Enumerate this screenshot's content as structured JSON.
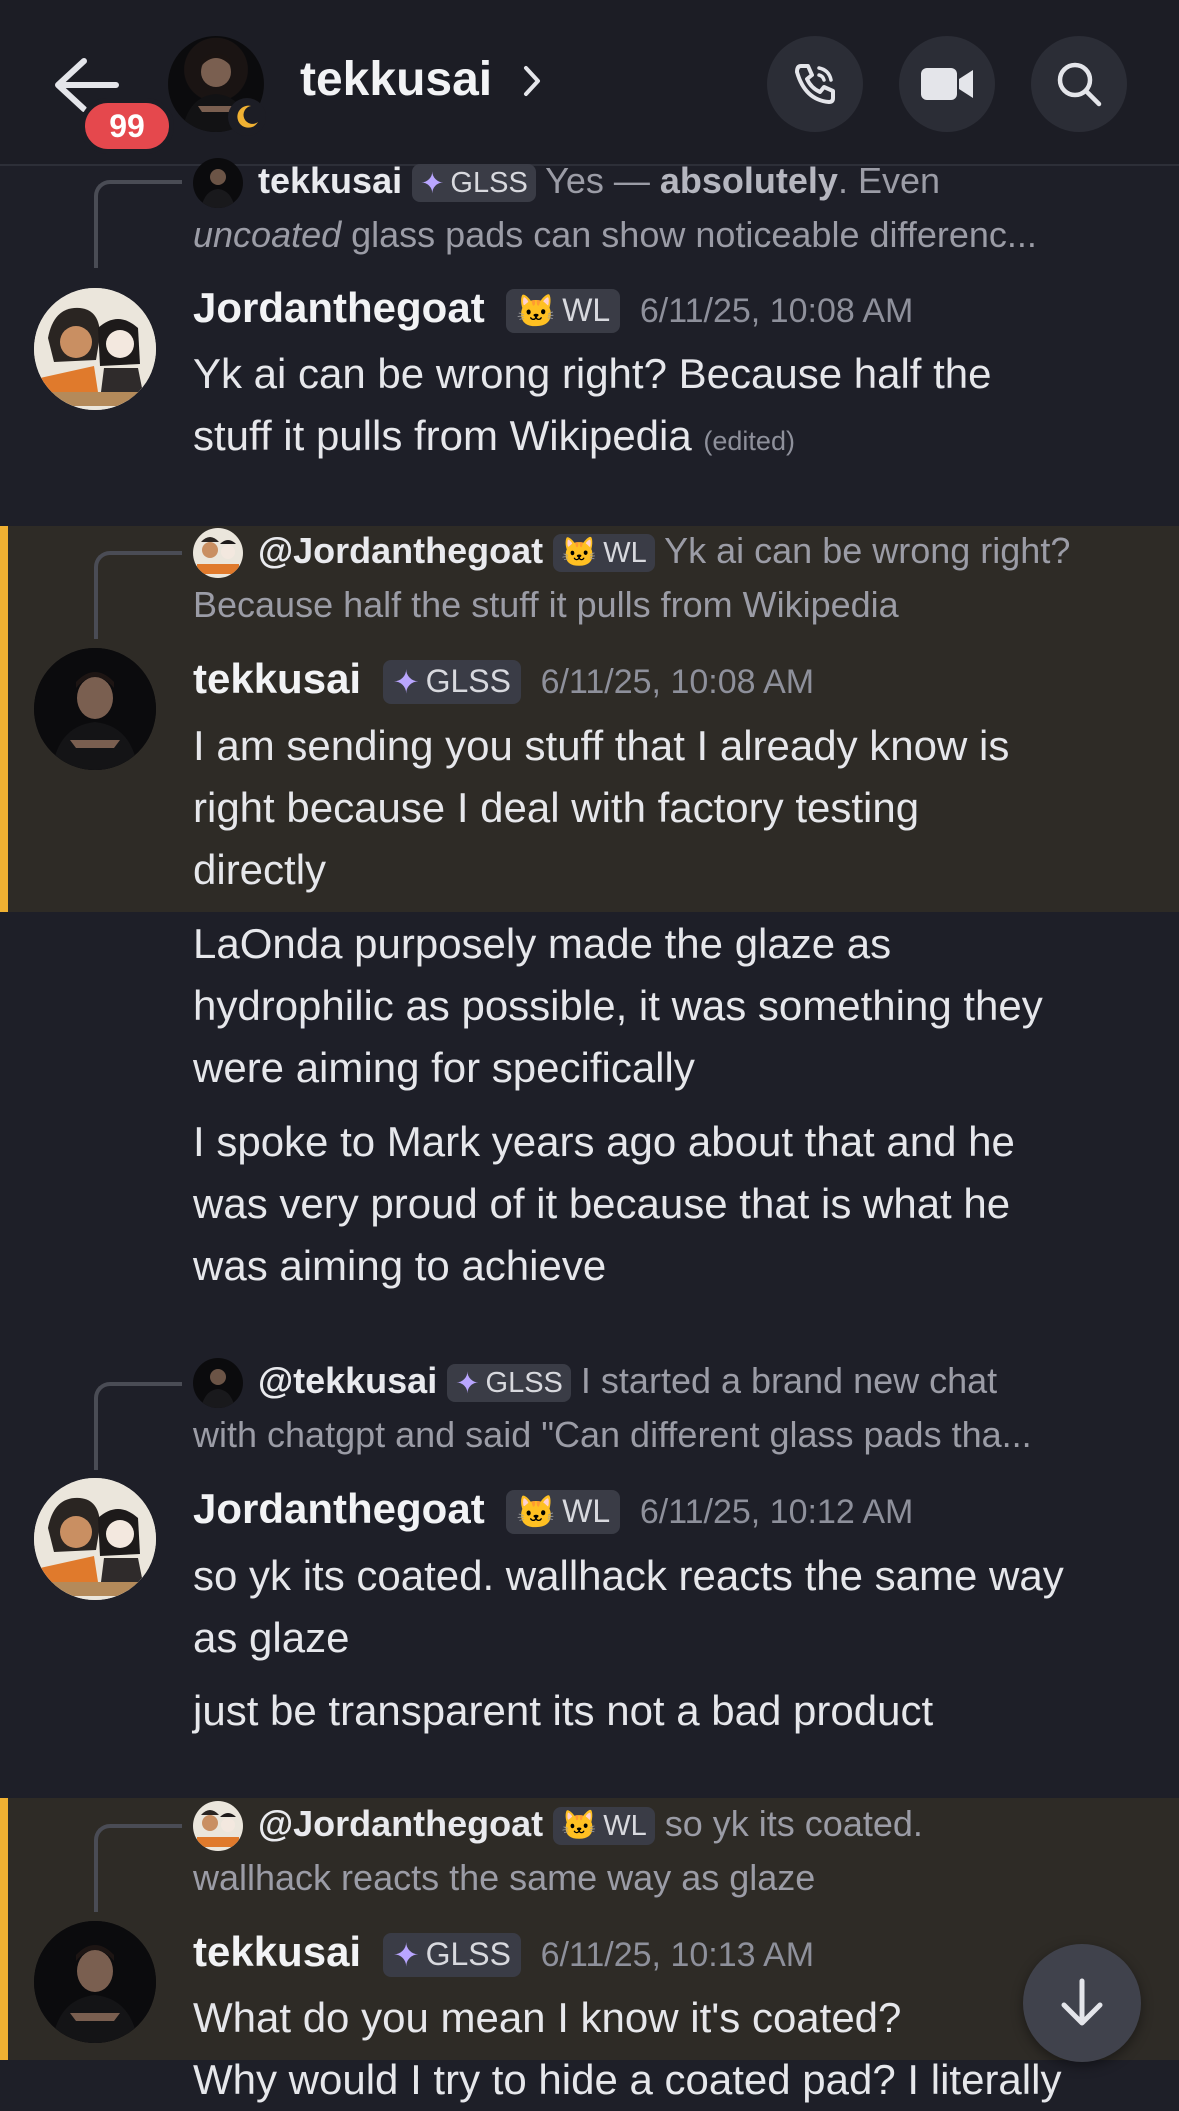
{
  "header": {
    "notification_count": "99",
    "title": "tekkusai"
  },
  "messages": [
    {
      "reply": {
        "name": "tekkusai",
        "tag": "GLSS",
        "text_a": "Yes — ",
        "text_bold": "absolutely",
        "text_b": ". Even",
        "line2_em": "uncoated",
        "line2_rest": " glass pads can show noticeable differenc..."
      },
      "author": "Jordanthegoat",
      "tag": "WL",
      "timestamp": "6/11/25, 10:08 AM",
      "lines": [
        "Yk ai can be wrong right? Because half the",
        "stuff it pulls from Wikipedia"
      ],
      "edited": "(edited)"
    },
    {
      "reply": {
        "name": "@Jordanthegoat",
        "tag": "WL",
        "line1": "Yk ai can be wrong right?",
        "line2": "Because half the stuff it pulls from Wikipedia"
      },
      "author": "tekkusai",
      "tag": "GLSS",
      "timestamp": "6/11/25, 10:08 AM",
      "lines": [
        "I am sending you stuff that I already know is",
        "right because I deal with factory testing",
        "directly"
      ]
    },
    {
      "lines": [
        "LaOnda purposely made the glaze as",
        "hydrophilic as possible, it was something they",
        "were aiming for specifically"
      ]
    },
    {
      "lines": [
        "I spoke to Mark years ago about that and he",
        "was very proud of it because that is what he",
        "was aiming to achieve"
      ]
    },
    {
      "reply": {
        "name": "@tekkusai",
        "tag": "GLSS",
        "line1": "I started a brand new chat",
        "line2": "with chatgpt and said \"Can different glass pads tha..."
      },
      "author": "Jordanthegoat",
      "tag": "WL",
      "timestamp": "6/11/25, 10:12 AM",
      "lines": [
        "so yk its coated. wallhack reacts the same way",
        "as glaze"
      ]
    },
    {
      "lines": [
        "just be transparent its not a bad product"
      ]
    },
    {
      "reply": {
        "name": "@Jordanthegoat",
        "tag": "WL",
        "line1": "so yk its coated.",
        "line2": "wallhack reacts the same way as glaze"
      },
      "author": "tekkusai",
      "tag": "GLSS",
      "timestamp": "6/11/25, 10:13 AM",
      "lines": [
        "What do you mean I know it's coated?",
        "Why would I try to hide a coated pad? I literally"
      ]
    }
  ],
  "colors": {
    "background": "#1e1f28",
    "highlight": "#2e2b26",
    "highlight_bar": "#f0b132",
    "badge": "#e5484d"
  }
}
